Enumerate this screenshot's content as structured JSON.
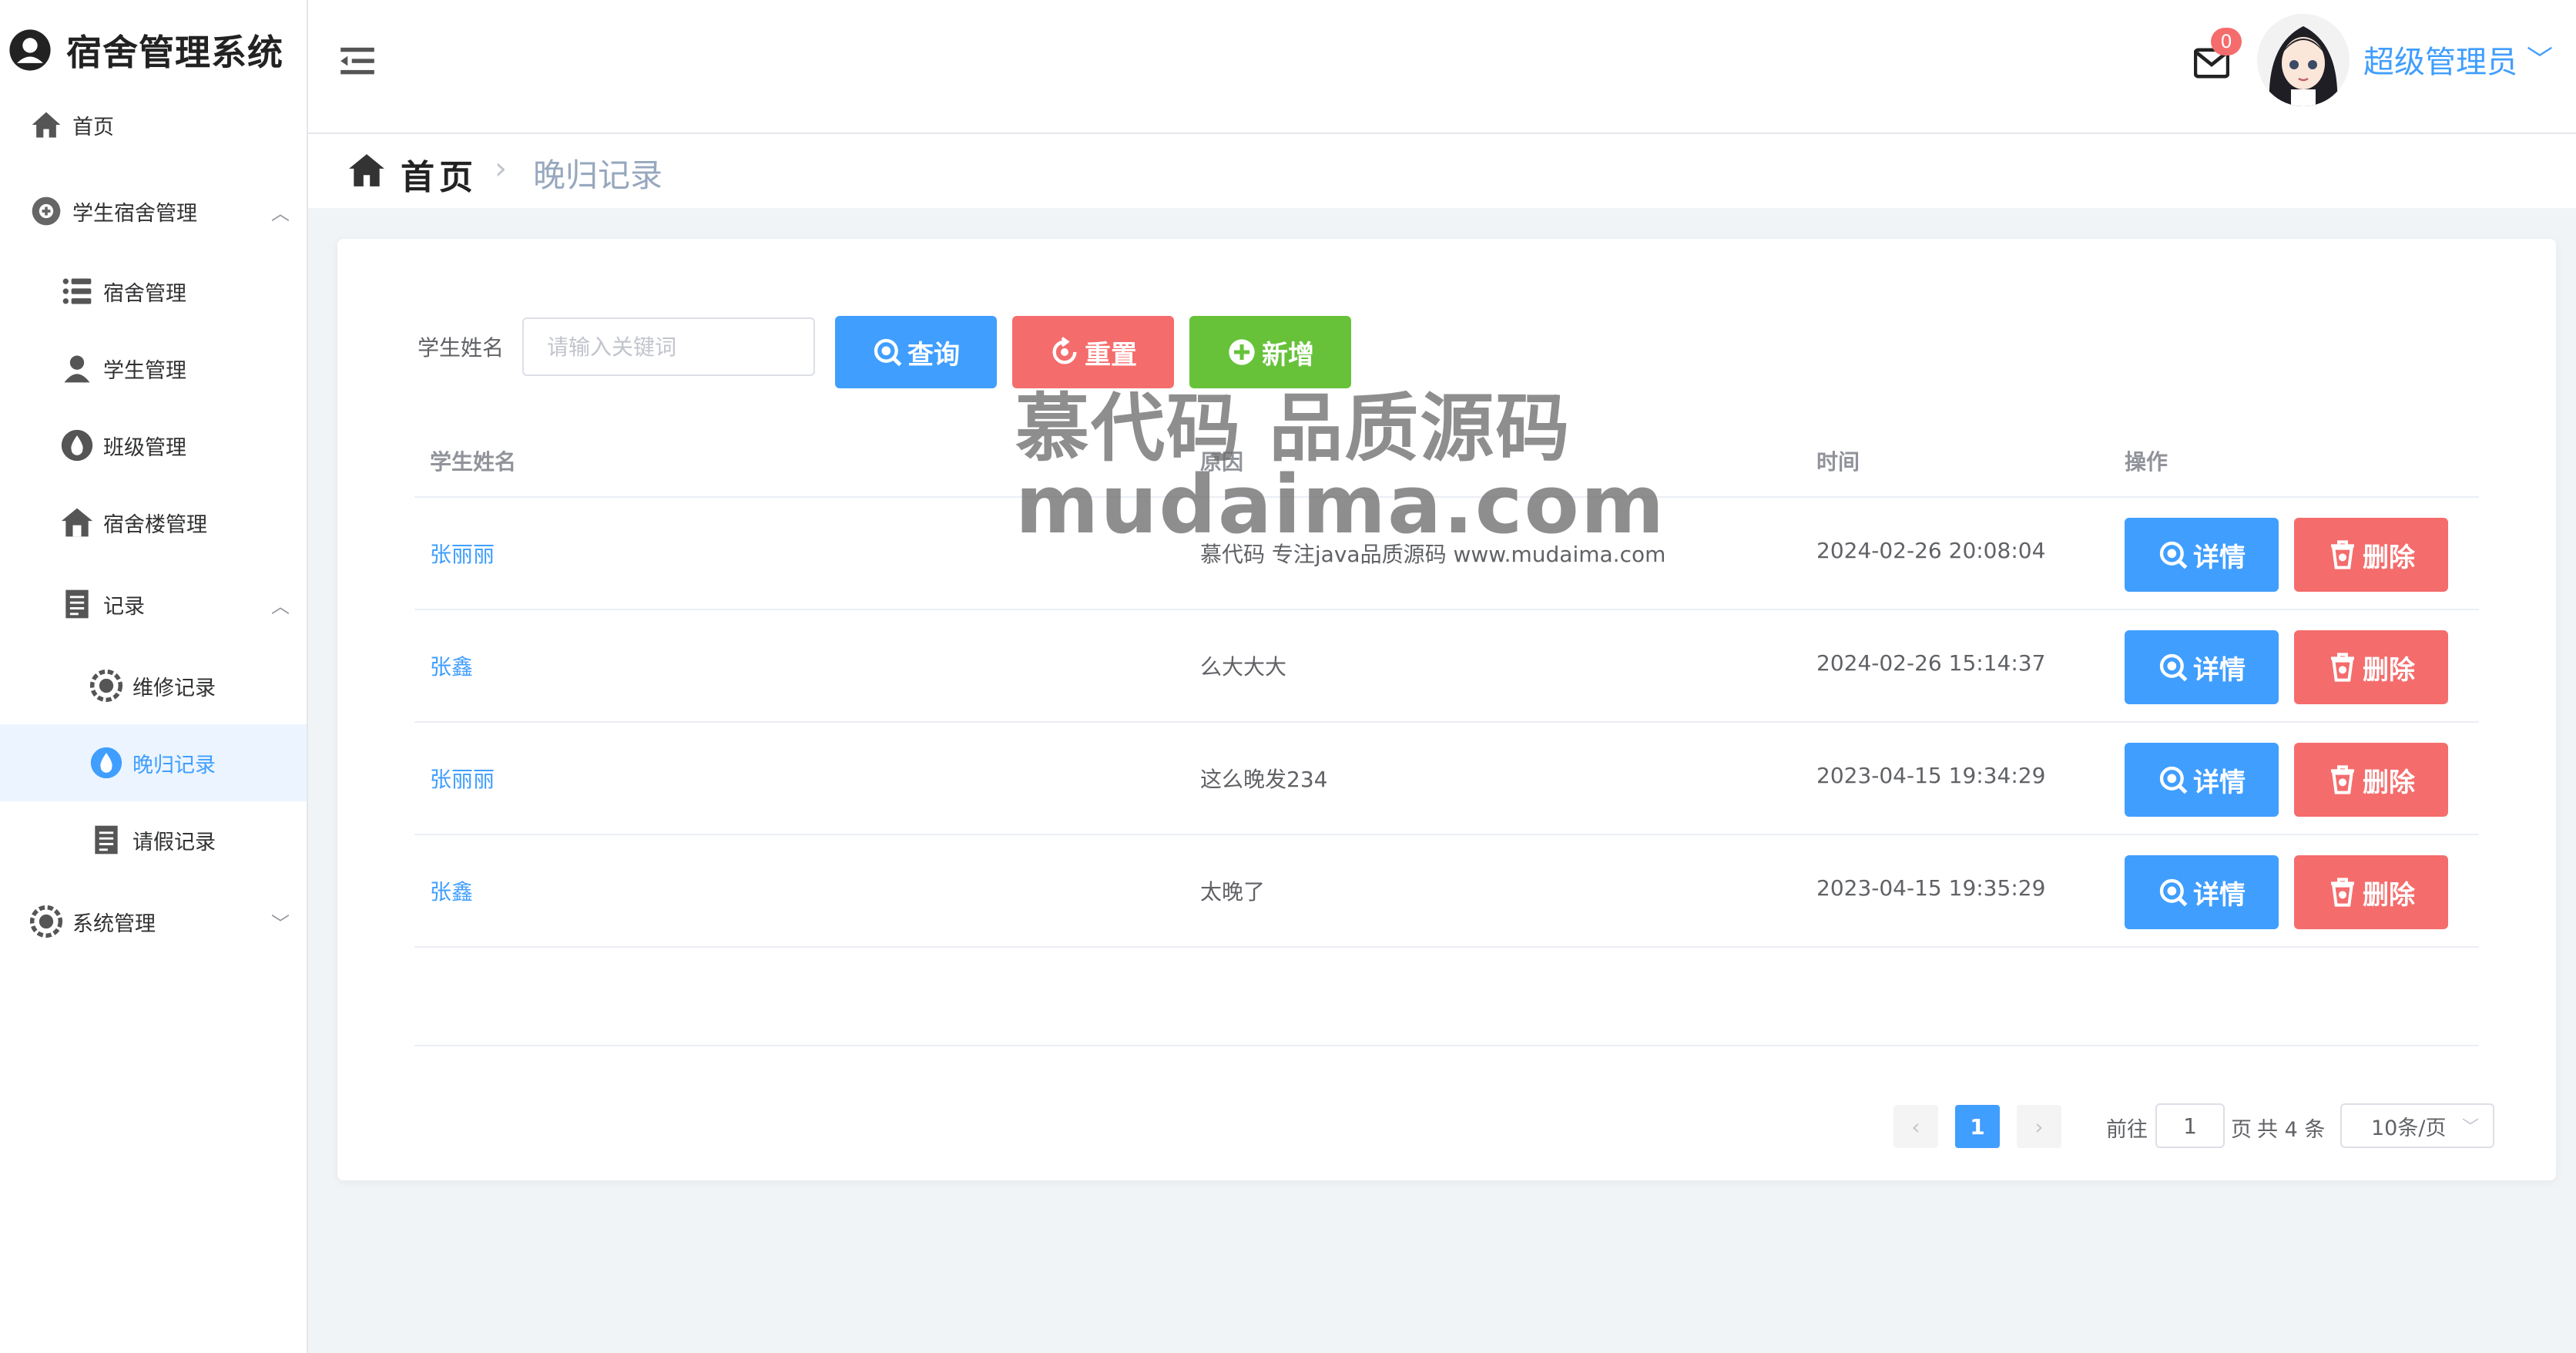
{
  "app": {
    "title": "宿舍管理系统"
  },
  "sidebar": {
    "items": [
      {
        "label": "首页"
      },
      {
        "label": "学生宿舍管理"
      },
      {
        "label": "宿舍管理"
      },
      {
        "label": "学生管理"
      },
      {
        "label": "班级管理"
      },
      {
        "label": "宿舍楼管理"
      },
      {
        "label": "记录"
      },
      {
        "label": "维修记录"
      },
      {
        "label": "晚归记录"
      },
      {
        "label": "请假记录"
      },
      {
        "label": "系统管理"
      }
    ]
  },
  "header": {
    "notification_count": "0",
    "username": "超级管理员"
  },
  "breadcrumb": {
    "home": "首页",
    "current": "晚归记录"
  },
  "search": {
    "label": "学生姓名",
    "placeholder": "请输入关键词",
    "query_label": "查询",
    "reset_label": "重置",
    "add_label": "新增"
  },
  "table": {
    "columns": [
      "学生姓名",
      "原因",
      "时间",
      "操作"
    ],
    "rows": [
      {
        "name": "张丽丽",
        "reason": "慕代码 专注java品质源码 www.mudaima.com",
        "time": "2024-02-26 20:08:04"
      },
      {
        "name": "张鑫",
        "reason": "么大大大",
        "time": "2024-02-26 15:14:37"
      },
      {
        "name": "张丽丽",
        "reason": "这么晚发234",
        "time": "2023-04-15 19:34:29"
      },
      {
        "name": "张鑫",
        "reason": "太晚了",
        "time": "2023-04-15 19:35:29"
      }
    ],
    "detail_label": "详情",
    "delete_label": "删除"
  },
  "pagination": {
    "current_page": "1",
    "goto_prefix": "前往",
    "goto_value": "1",
    "goto_suffix": "页",
    "total_text": "共 4 条",
    "page_size": "10条/页"
  },
  "watermark": {
    "line1": "慕代码 品质源码",
    "line2": "mudaima.com"
  },
  "colors": {
    "primary": "#409eff",
    "danger": "#f56c6c",
    "success": "#67c23a"
  }
}
